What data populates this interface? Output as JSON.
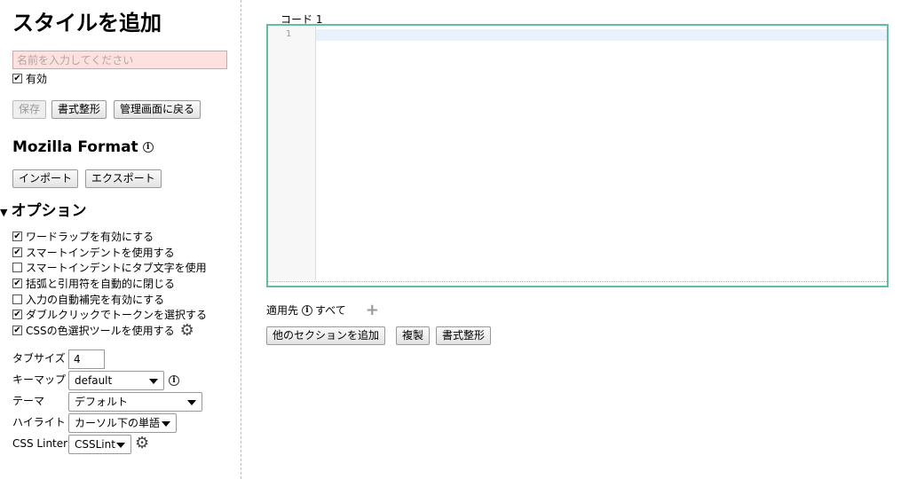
{
  "sidebar": {
    "title": "スタイルを追加",
    "name_placeholder": "名前を入力してください",
    "enabled": {
      "label": "有効",
      "checked": true
    },
    "buttons": {
      "save": "保存",
      "beautify": "書式整形",
      "back": "管理画面に戻る"
    },
    "format_heading": "Mozilla Format",
    "import": "インポート",
    "export": "エクスポート",
    "options_title": "オプション",
    "options": [
      {
        "label": "ワードラップを有効にする",
        "checked": true
      },
      {
        "label": "スマートインデントを使用する",
        "checked": true
      },
      {
        "label": "スマートインデントにタブ文字を使用",
        "checked": false
      },
      {
        "label": "括弧と引用符を自動的に閉じる",
        "checked": true
      },
      {
        "label": "入力の自動補完を有効にする",
        "checked": false
      },
      {
        "label": "ダブルクリックでトークンを選択する",
        "checked": true
      },
      {
        "label": "CSSの色選択ツールを使用する",
        "checked": true
      }
    ],
    "tab_size": {
      "label": "タブサイズ",
      "value": "4"
    },
    "keymap": {
      "label": "キーマップ",
      "value": "default"
    },
    "theme": {
      "label": "テーマ",
      "value": "デフォルト"
    },
    "highlight": {
      "label": "ハイライト",
      "value": "カーソル下の単語"
    },
    "linter": {
      "label": "CSS Linter",
      "value": "CSSLint"
    }
  },
  "main": {
    "code_label": "コード 1",
    "line_number": "1",
    "applies_to": "適用先",
    "applies_all": "すべて",
    "buttons": {
      "add_section": "他のセクションを追加",
      "clone": "複製",
      "beautify": "書式整形"
    }
  },
  "colors": {
    "editor_border": "#5fbf9f",
    "name_input_bg": "#fde0e0"
  }
}
